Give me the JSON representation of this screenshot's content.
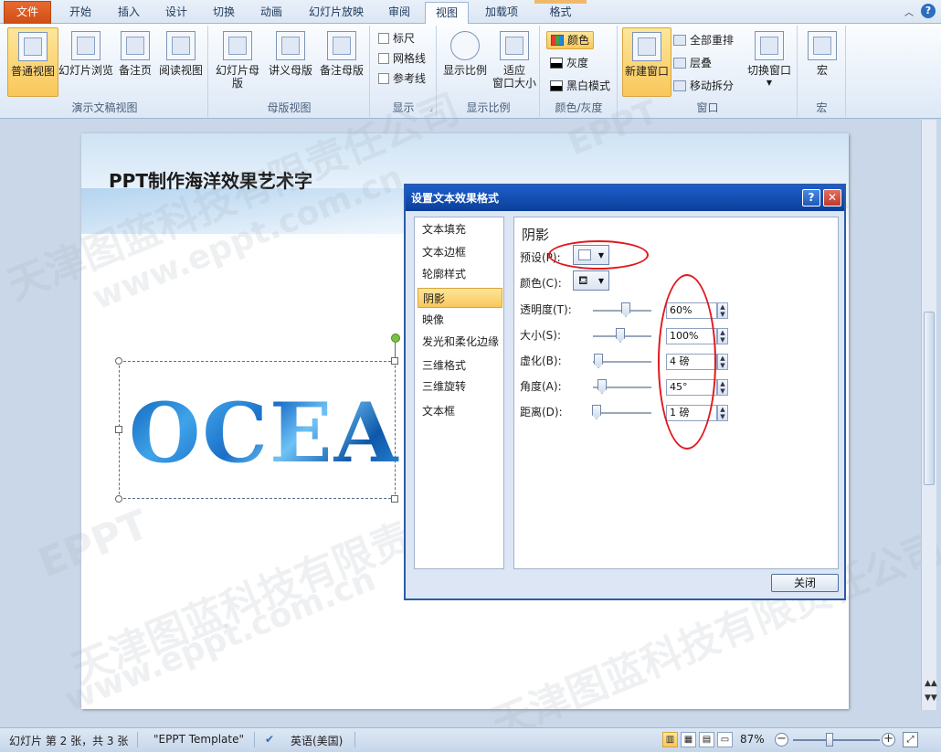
{
  "ribbon": {
    "tabs": [
      {
        "label": "文件"
      },
      {
        "label": "开始"
      },
      {
        "label": "插入"
      },
      {
        "label": "设计"
      },
      {
        "label": "切换"
      },
      {
        "label": "动画"
      },
      {
        "label": "幻灯片放映"
      },
      {
        "label": "审阅"
      },
      {
        "label": "视图"
      },
      {
        "label": "加载项"
      },
      {
        "label": "格式"
      }
    ],
    "groups": {
      "presentation_views": {
        "label": "演示文稿视图",
        "buttons": [
          "普通视图",
          "幻灯片浏览",
          "备注页",
          "阅读视图"
        ]
      },
      "master_views": {
        "label": "母版视图",
        "buttons": [
          "幻灯片母版",
          "讲义母版",
          "备注母版"
        ]
      },
      "show": {
        "label": "显示",
        "checkboxes": [
          "标尺",
          "网格线",
          "参考线"
        ]
      },
      "zoom": {
        "label": "显示比例",
        "buttons": [
          "显示比例",
          "适应",
          "窗口大小"
        ]
      },
      "color_grayscale": {
        "label": "颜色/灰度",
        "options": [
          "颜色",
          "灰度",
          "黑白模式"
        ]
      },
      "window": {
        "label": "窗口",
        "new_window": "新建窗口",
        "options": [
          "全部重排",
          "层叠",
          "移动拆分"
        ],
        "switch": "切换窗口"
      },
      "macros": {
        "label": "宏",
        "button": "宏"
      }
    }
  },
  "slide": {
    "title": "PPT制作海洋效果艺术字",
    "art_text": "OCEA"
  },
  "watermarks": [
    "天津图蓝科技有限责任公司",
    "www.eppt.com.cn",
    "EPPT"
  ],
  "dialog": {
    "title": "设置文本效果格式",
    "help": "?",
    "close_x": "✕",
    "nav": [
      "文本填充",
      "文本边框",
      "轮廓样式",
      "阴影",
      "映像",
      "发光和柔化边缘",
      "三维格式",
      "三维旋转",
      "文本框"
    ],
    "active_nav": "阴影",
    "panel_heading": "阴影",
    "preset_label": "预设(P):",
    "color_label": "颜色(C):",
    "properties": [
      {
        "label": "透明度(T):",
        "value": "60%"
      },
      {
        "label": "大小(S):",
        "value": "100%"
      },
      {
        "label": "虚化(B):",
        "value": "4 磅"
      },
      {
        "label": "角度(A):",
        "value": "45°"
      },
      {
        "label": "距离(D):",
        "value": "1 磅"
      }
    ],
    "close_button": "关闭"
  },
  "statusbar": {
    "slide_info": "幻灯片 第 2 张，共 3 张",
    "template": "\"EPPT Template\"",
    "language": "英语(美国)",
    "zoom": "87%"
  },
  "colors": {
    "file_tab": "#d95b23",
    "selection": "#f9c75b",
    "dialog_title": "#1c5fc9",
    "annotation": "#e0191e"
  }
}
